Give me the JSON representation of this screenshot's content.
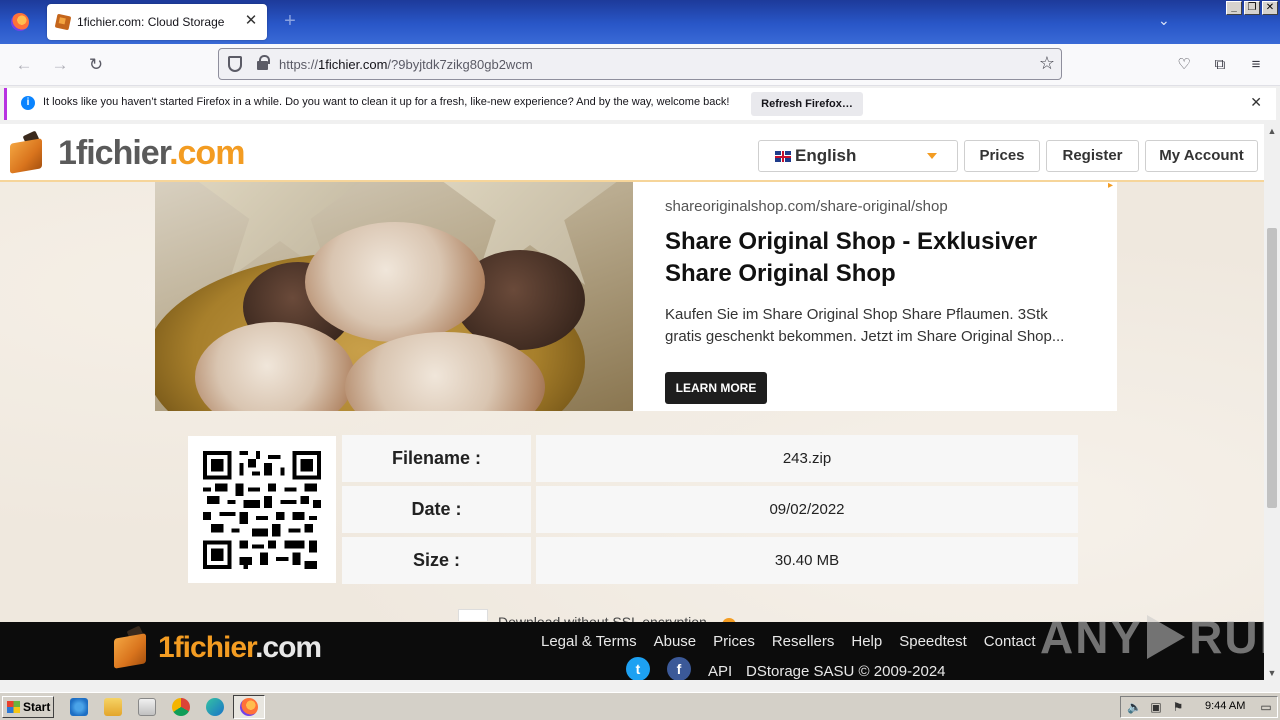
{
  "browser": {
    "tab_title": "1fichier.com: Cloud Storage",
    "url_prefix": "https://",
    "url_host": "1fichier.com",
    "url_path": "/?9byjtdk7zikg80gb2wcm",
    "notification_text": "It looks like you haven’t started Firefox in a while. Do you want to clean it up for a fresh, like-new experience? And by the way, welcome back!",
    "notification_button": "Refresh Firefox…"
  },
  "site": {
    "logo_text_main": "1fichier",
    "logo_text_accent": ".com",
    "language": "English",
    "nav": {
      "prices": "Prices",
      "register": "Register",
      "account": "My Account"
    }
  },
  "ad": {
    "domain": "shareoriginalshop.com/share-original/shop",
    "title": "Share Original Shop - Exklusiver Share Original Shop",
    "description": "Kaufen Sie im Share Original Shop Share Pflaumen. 3Stk gratis geschenkt bekommen. Jetzt im Share Original Shop...",
    "cta": "LEARN MORE"
  },
  "file": {
    "rows": [
      {
        "label": "Filename :",
        "value": "243.zip"
      },
      {
        "label": "Date :",
        "value": "09/02/2022"
      },
      {
        "label": "Size :",
        "value": "30.40 MB"
      }
    ],
    "partial_text": "Download without SSL encryption"
  },
  "footer": {
    "logo_text_main": "1fichier",
    "logo_text_accent": ".com",
    "links": [
      "Legal & Terms",
      "Abuse",
      "Prices",
      "Resellers",
      "Help",
      "Speedtest",
      "Contact"
    ],
    "api": "API",
    "copyright": "DStorage SASU © 2009-2024"
  },
  "watermark": {
    "left": "ANY",
    "right": "RUN"
  },
  "taskbar": {
    "start": "Start",
    "clock": "9:44 AM"
  },
  "colors": {
    "accent": "#f39c22",
    "footer_bg": "#0c0c0c",
    "cta_bg": "#1e1e1e"
  }
}
